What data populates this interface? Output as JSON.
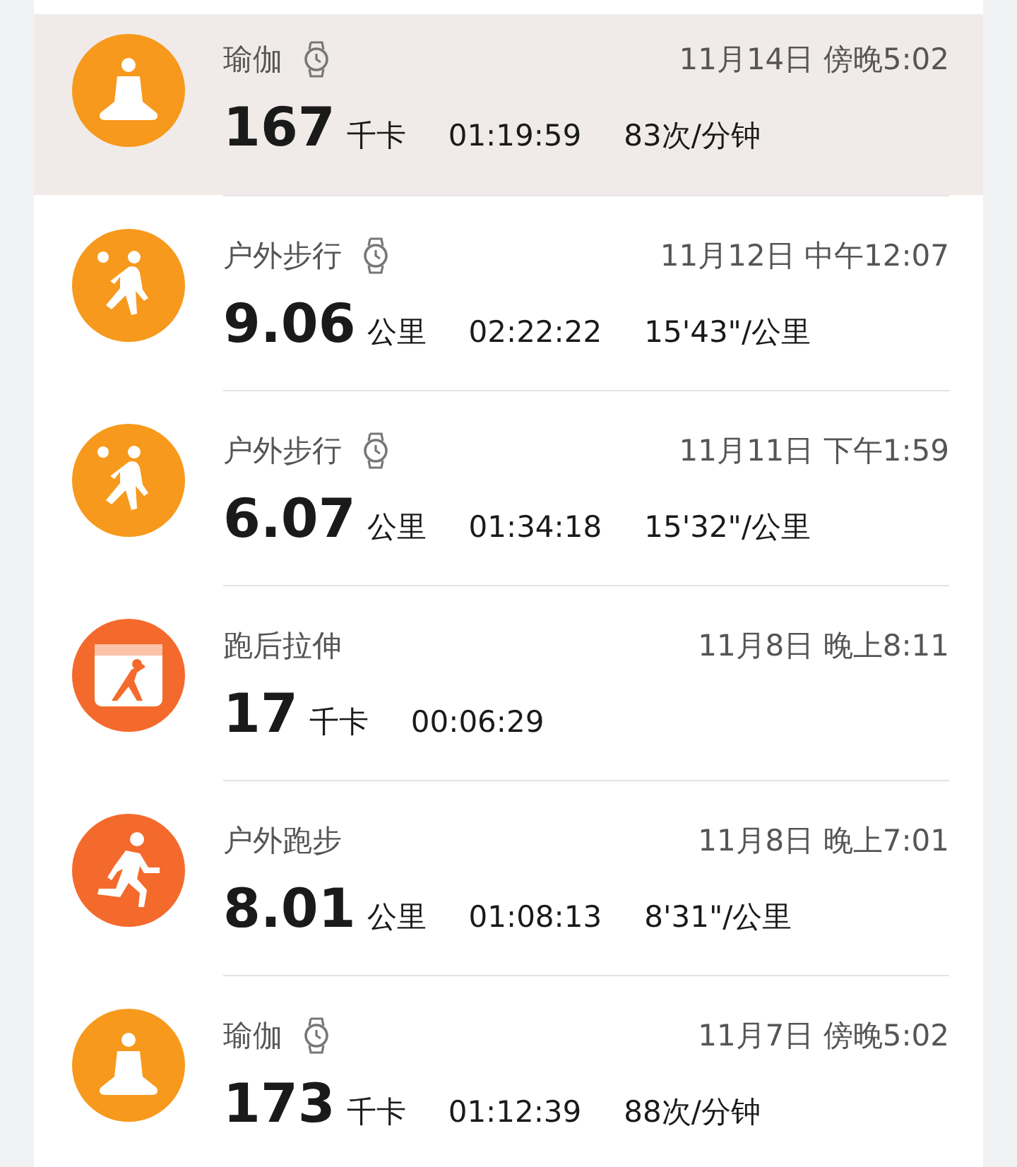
{
  "activities": [
    {
      "kind": "yoga",
      "color": "#f7991c",
      "title": "瑜伽",
      "watch": true,
      "date": "11月14日 傍晚5:02",
      "value": "167",
      "unit": "千卡",
      "duration": "01:19:59",
      "metric": "83次/分钟",
      "selected": true
    },
    {
      "kind": "walk",
      "color": "#f7991c",
      "title": "户外步行",
      "watch": true,
      "date": "11月12日 中午12:07",
      "value": "9.06",
      "unit": "公里",
      "duration": "02:22:22",
      "metric": "15'43\"/公里",
      "selected": false
    },
    {
      "kind": "walk",
      "color": "#f7991c",
      "title": "户外步行",
      "watch": true,
      "date": "11月11日 下午1:59",
      "value": "6.07",
      "unit": "公里",
      "duration": "01:34:18",
      "metric": "15'32\"/公里",
      "selected": false
    },
    {
      "kind": "stretch",
      "color": "#f46a2c",
      "title": "跑后拉伸",
      "watch": false,
      "date": "11月8日 晚上8:11",
      "value": "17",
      "unit": "千卡",
      "duration": "00:06:29",
      "selected": false
    },
    {
      "kind": "run",
      "color": "#f46a2c",
      "title": "户外跑步",
      "watch": false,
      "date": "11月8日 晚上7:01",
      "value": "8.01",
      "unit": "公里",
      "duration": "01:08:13",
      "metric": "8'31\"/公里",
      "selected": false
    },
    {
      "kind": "yoga",
      "color": "#f7991c",
      "title": "瑜伽",
      "watch": true,
      "date": "11月7日 傍晚5:02",
      "value": "173",
      "unit": "千卡",
      "duration": "01:12:39",
      "metric": "88次/分钟",
      "selected": false
    }
  ]
}
